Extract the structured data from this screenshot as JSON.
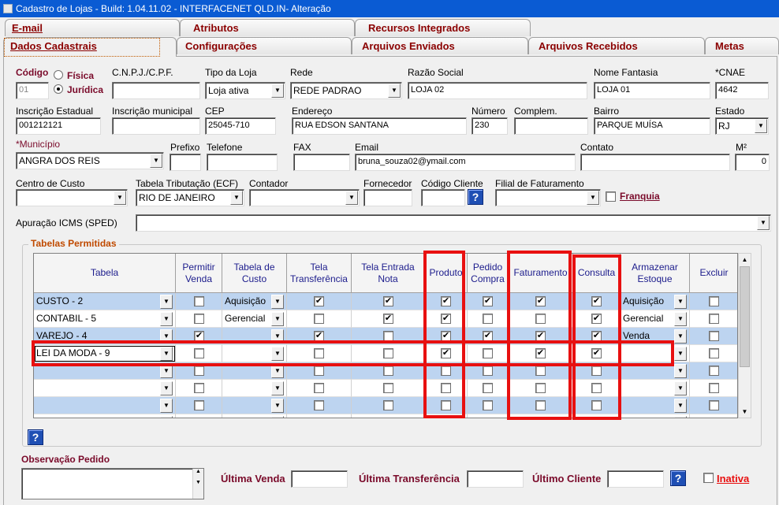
{
  "window": {
    "title": "Cadastro de Lojas - Build: 1.04.11.02 - INTERFACENET QLD.IN- Alteração"
  },
  "tabs": {
    "row1": [
      {
        "label": "E-mail",
        "u": ""
      },
      {
        "label": "Atributos",
        "u": ""
      },
      {
        "label": "Recursos Integrados",
        "u": ""
      }
    ],
    "row2": [
      {
        "label": "Dados Cadastrais"
      },
      {
        "label": "Configurações"
      },
      {
        "label": "Arquivos Enviados"
      },
      {
        "label": "Arquivos Recebidos"
      },
      {
        "label": "Metas"
      }
    ]
  },
  "form": {
    "codigo": {
      "label": "Código",
      "value": "01"
    },
    "tipo_pessoa": {
      "fisica": "Física",
      "juridica": "Jurídica",
      "selected": "juridica"
    },
    "cnpj": {
      "label": "C.N.P.J./C.P.F.",
      "value": ""
    },
    "tipo_loja": {
      "label": "Tipo da Loja",
      "value": "Loja ativa"
    },
    "rede": {
      "label": "Rede",
      "value": "REDE PADRAO"
    },
    "razao_social": {
      "label": "Razão Social",
      "value": "LOJA 02"
    },
    "nome_fantasia": {
      "label": "Nome Fantasia",
      "value": "LOJA 01"
    },
    "cnae": {
      "label": "*CNAE",
      "value": "4642"
    },
    "inscricao_estadual": {
      "label": "Inscrição Estadual",
      "value": "001212121"
    },
    "inscricao_municipal": {
      "label": "Inscrição municipal",
      "value": ""
    },
    "cep": {
      "label": "CEP",
      "value": "25045-710"
    },
    "endereco": {
      "label": "Endereço",
      "value": "RUA EDSON SANTANA"
    },
    "numero": {
      "label": "Número",
      "value": "230"
    },
    "complemento": {
      "label": "Complem.",
      "value": ""
    },
    "bairro": {
      "label": "Bairro",
      "value": "PARQUE MUÍSA"
    },
    "estado": {
      "label": "Estado",
      "value": "RJ"
    },
    "municipio": {
      "label": "*Município",
      "value": "ANGRA DOS REIS"
    },
    "prefixo": {
      "label": "Prefixo",
      "value": ""
    },
    "telefone": {
      "label": "Telefone",
      "value": ""
    },
    "fax": {
      "label": "FAX",
      "value": ""
    },
    "email": {
      "label": "Email",
      "value": "bruna_souza02@ymail.com"
    },
    "contato": {
      "label": "Contato",
      "value": ""
    },
    "m2": {
      "label": "M²",
      "value": "0"
    },
    "centro_custo": {
      "label": "Centro de Custo",
      "value": ""
    },
    "tabela_tributacao": {
      "label": "Tabela Tributação (ECF)",
      "value": "RIO DE JANEIRO"
    },
    "contador": {
      "label": "Contador",
      "value": ""
    },
    "fornecedor": {
      "label": "Fornecedor",
      "value": ""
    },
    "codigo_cliente": {
      "label": "Código Cliente",
      "value": ""
    },
    "filial_faturamento": {
      "label": "Filial de Faturamento",
      "value": ""
    },
    "franquia": {
      "label": "Franquia",
      "checked": false
    },
    "apuracao_icms": {
      "label": "Apuração ICMS (SPED)",
      "value": ""
    }
  },
  "tabelas": {
    "title": "Tabelas Permitidas",
    "columns": [
      "Tabela",
      "Permitir Venda",
      "Tabela de Custo",
      "Tela Transferência",
      "Tela Entrada Nota",
      "Produto",
      "Pedido Compra",
      "Faturamento",
      "Consulta",
      "Armazenar Estoque",
      "Excluir"
    ],
    "rows": [
      {
        "tabela": "CUSTO - 2",
        "permitir_venda": false,
        "tabela_custo": "Aquisição",
        "tela_transf": true,
        "tela_entrada": true,
        "produto": true,
        "pedido_compra": true,
        "faturamento": true,
        "consulta": true,
        "armazenar": "Aquisição",
        "excluir": false
      },
      {
        "tabela": "CONTABIL - 5",
        "permitir_venda": false,
        "tabela_custo": "Gerencial",
        "tela_transf": false,
        "tela_entrada": true,
        "produto": true,
        "pedido_compra": false,
        "faturamento": false,
        "consulta": true,
        "armazenar": "Gerencial",
        "excluir": false
      },
      {
        "tabela": "VAREJO - 4",
        "permitir_venda": true,
        "tabela_custo": "",
        "tela_transf": true,
        "tela_entrada": false,
        "produto": true,
        "pedido_compra": true,
        "faturamento": true,
        "consulta": true,
        "armazenar": "Venda",
        "excluir": false
      },
      {
        "tabela": "LEI DA MODA - 9",
        "permitir_venda": false,
        "tabela_custo": "",
        "tela_transf": false,
        "tela_entrada": false,
        "produto": true,
        "pedido_compra": false,
        "faturamento": true,
        "consulta": true,
        "armazenar": "",
        "excluir": false
      },
      {
        "tabela": "",
        "permitir_venda": false,
        "tabela_custo": "",
        "tela_transf": false,
        "tela_entrada": false,
        "produto": false,
        "pedido_compra": false,
        "faturamento": false,
        "consulta": false,
        "armazenar": "",
        "excluir": false
      },
      {
        "tabela": "",
        "permitir_venda": false,
        "tabela_custo": "",
        "tela_transf": false,
        "tela_entrada": false,
        "produto": false,
        "pedido_compra": false,
        "faturamento": false,
        "consulta": false,
        "armazenar": "",
        "excluir": false
      },
      {
        "tabela": "",
        "permitir_venda": false,
        "tabela_custo": "",
        "tela_transf": false,
        "tela_entrada": false,
        "produto": false,
        "pedido_compra": false,
        "faturamento": false,
        "consulta": false,
        "armazenar": "",
        "excluir": false
      },
      {
        "tabela": "",
        "permitir_venda": false,
        "tabela_custo": "",
        "tela_transf": false,
        "tela_entrada": false,
        "produto": false,
        "pedido_compra": false,
        "faturamento": false,
        "consulta": false,
        "armazenar": "",
        "excluir": false
      }
    ]
  },
  "footer": {
    "observacao": {
      "label": "Observação Pedido",
      "value": ""
    },
    "ultima_venda": {
      "label": "Última Venda",
      "value": ""
    },
    "ultima_transferencia": {
      "label": "Última Transferência",
      "value": ""
    },
    "ultimo_cliente": {
      "label": "Último Cliente",
      "value": ""
    },
    "inativa": {
      "label": "Inativa",
      "checked": false
    }
  },
  "colors": {
    "titlebar": "#0a5bd3",
    "row_blue": "#bdd4f0",
    "highlight_red": "#e81010",
    "tab_text": "#8b0000"
  },
  "icons": {
    "help": "?",
    "dropdown": "▼",
    "check": "✔"
  }
}
